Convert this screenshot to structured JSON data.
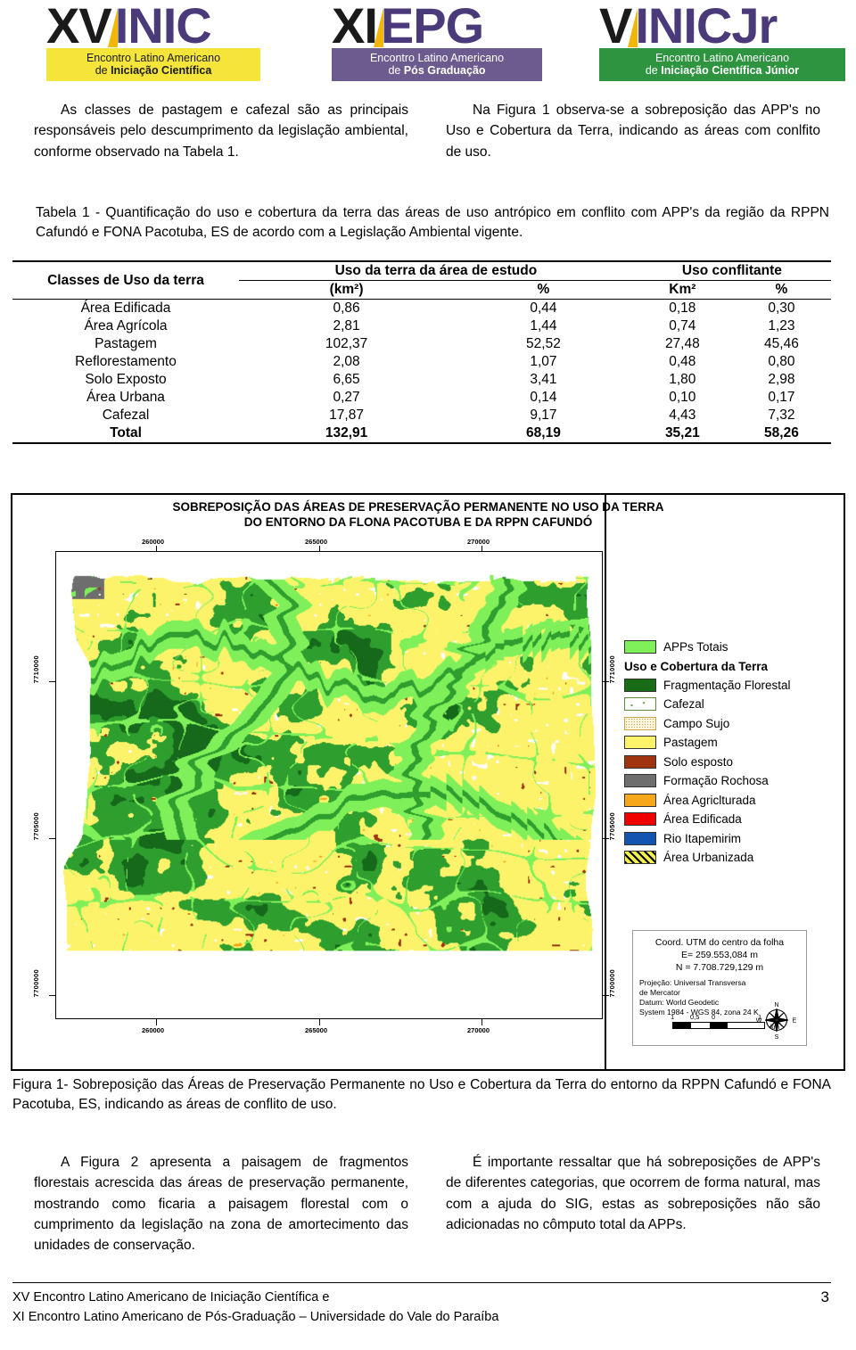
{
  "header": {
    "logos": [
      {
        "prefix": "XV",
        "suffix": "INIC",
        "banner_line1": "Encontro Latino Americano",
        "banner_line2_plain": "de ",
        "banner_line2_bold": "Iniciação Científica",
        "banner_color": "#f5e53b"
      },
      {
        "prefix": "XI",
        "suffix": "EPG",
        "banner_line1": "Encontro Latino Americano",
        "banner_line2_plain": "de ",
        "banner_line2_bold": "Pós Graduação",
        "banner_color": "#6b5b8e"
      },
      {
        "prefix": "V",
        "suffix": "INIC",
        "suffix2": "Jr",
        "banner_line1": "Encontro Latino Americano",
        "banner_line2_plain": "de ",
        "banner_line2_bold": "Iniciação Científica Júnior",
        "banner_color": "#2e9440"
      }
    ]
  },
  "intro": {
    "left": "As classes de pastagem e cafezal são as principais responsáveis pelo descumprimento da legislação ambiental, conforme observado na Tabela 1.",
    "right": "Na Figura 1 observa-se a sobreposição das APP's no Uso e Cobertura da Terra, indicando as áreas com conlfito de uso."
  },
  "table": {
    "caption": "Tabela 1 - Quantificação do uso e cobertura da terra das áreas de uso antrópico em conflito com APP's da região da RPPN Cafundó e FONA Pacotuba, ES de acordo com a Legislação Ambiental vigente.",
    "col_classes": "Classes de Uso da terra",
    "group1": "Uso da terra da área de estudo",
    "group2": "Uso conflitante",
    "sub1": "(km²)",
    "sub2": "%",
    "sub3": "Km²",
    "sub4": "%",
    "rows": [
      {
        "classe": "Área Edificada",
        "area": "0,86",
        "area_pct": "0,44",
        "conf": "0,18",
        "conf_pct": "0,30"
      },
      {
        "classe": "Área Agrícola",
        "area": "2,81",
        "area_pct": "1,44",
        "conf": "0,74",
        "conf_pct": "1,23"
      },
      {
        "classe": "Pastagem",
        "area": "102,37",
        "area_pct": "52,52",
        "conf": "27,48",
        "conf_pct": "45,46"
      },
      {
        "classe": "Reflorestamento",
        "area": "2,08",
        "area_pct": "1,07",
        "conf": "0,48",
        "conf_pct": "0,80"
      },
      {
        "classe": "Solo Exposto",
        "area": "6,65",
        "area_pct": "3,41",
        "conf": "1,80",
        "conf_pct": "2,98"
      },
      {
        "classe": "Área Urbana",
        "area": "0,27",
        "area_pct": "0,14",
        "conf": "0,10",
        "conf_pct": "0,17"
      },
      {
        "classe": "Cafezal",
        "area": "17,87",
        "area_pct": "9,17",
        "conf": "4,43",
        "conf_pct": "7,32"
      }
    ],
    "total": {
      "classe": "Total",
      "area": "132,91",
      "area_pct": "68,19",
      "conf": "35,21",
      "conf_pct": "58,26"
    }
  },
  "map": {
    "title_line1": "SOBREPOSIÇÃO DAS ÁREAS DE PRESERVAÇÃO PERMANENTE NO USO DA TERRA",
    "title_line2": "DO ENTORNO DA FLONA PACOTUBA E DA RPPN CAFUNDÓ",
    "x_ticks": [
      "260000",
      "265000",
      "270000"
    ],
    "y_ticks": [
      "7710000",
      "7705000",
      "7700000"
    ],
    "legend": {
      "first": {
        "label": "APPs Totais",
        "color": "#7ff05a"
      },
      "heading": "Uso e Cobertura da Terra",
      "items": [
        {
          "label": "Fragmentação Florestal",
          "color": "#1a6b16",
          "pattern": "solid"
        },
        {
          "label": "Cafezal",
          "color": "#ffffff",
          "pattern": "cafezal"
        },
        {
          "label": "Campo Sujo",
          "color": "#fdf6e0",
          "pattern": "dots"
        },
        {
          "label": "Pastagem",
          "color": "#fdf36a",
          "pattern": "solid"
        },
        {
          "label": "Solo esposto",
          "color": "#a03410",
          "pattern": "solid"
        },
        {
          "label": "Formação Rochosa",
          "color": "#6e6e6e",
          "pattern": "solid"
        },
        {
          "label": "Área Agriclturada",
          "color": "#f7a71a",
          "pattern": "solid"
        },
        {
          "label": "Área Edificada",
          "color": "#f00000",
          "pattern": "solid"
        },
        {
          "label": "Rio Itapemirim",
          "color": "#1155b0",
          "pattern": "solid"
        },
        {
          "label": "Área Urbanizada",
          "color": "#f3ee4a",
          "pattern": "hatch"
        }
      ]
    },
    "coordbox": {
      "title": "Coord. UTM do centro da folha",
      "east": "E= 259.553,084 m",
      "north": "N = 7.708.729,129 m",
      "proj1": "Projeção: Universal Transversa",
      "proj2": "de Mercator",
      "datum1": "Datum: World Geodetic",
      "datum2": "System 1984 - WGS 84, zona 24 K",
      "scale_labels": [
        "1",
        "0,5",
        "0",
        "1"
      ],
      "scale_unit": "km",
      "compass": {
        "n": "N",
        "s": "S",
        "e": "E",
        "w": "W"
      }
    }
  },
  "figure_caption": "Figura 1- Sobreposição das Áreas de Preservação Permanente no Uso e Cobertura da Terra do entorno da RPPN Cafundó e FONA Pacotuba, ES, indicando as áreas de conflito de uso.",
  "body": {
    "left": "A Figura 2 apresenta a paisagem de fragmentos florestais acrescida das áreas de preservação permanente, mostrando como ficaria a paisagem florestal com o cumprimento da legislação na zona de amortecimento das unidades de conservação.",
    "right": "É importante ressaltar que há sobreposições de APP's de diferentes categorias, que ocorrem de forma natural, mas com a ajuda do SIG, estas as sobreposições não são adicionadas no cômputo total da APPs."
  },
  "footer": {
    "line1": "XV Encontro Latino Americano de Iniciação Científica e",
    "line2": "XI Encontro Latino Americano de Pós-Graduação – Universidade do Vale do Paraíba",
    "page": "3"
  },
  "chart_data": {
    "type": "table",
    "title": "Quantificação do uso e cobertura da terra das áreas de uso antrópico em conflito com APP's",
    "categories": [
      "Área Edificada",
      "Área Agrícola",
      "Pastagem",
      "Reflorestamento",
      "Solo Exposto",
      "Área Urbana",
      "Cafezal",
      "Total"
    ],
    "series": [
      {
        "name": "Uso da terra da área de estudo (km²)",
        "values": [
          0.86,
          2.81,
          102.37,
          2.08,
          6.65,
          0.27,
          17.87,
          132.91
        ]
      },
      {
        "name": "Uso da terra da área de estudo (%)",
        "values": [
          0.44,
          1.44,
          52.52,
          1.07,
          3.41,
          0.14,
          9.17,
          68.19
        ]
      },
      {
        "name": "Uso conflitante (Km²)",
        "values": [
          0.18,
          0.74,
          27.48,
          0.48,
          1.8,
          0.1,
          4.43,
          35.21
        ]
      },
      {
        "name": "Uso conflitante (%)",
        "values": [
          0.3,
          1.23,
          45.46,
          0.8,
          2.98,
          0.17,
          7.32,
          58.26
        ]
      }
    ]
  }
}
